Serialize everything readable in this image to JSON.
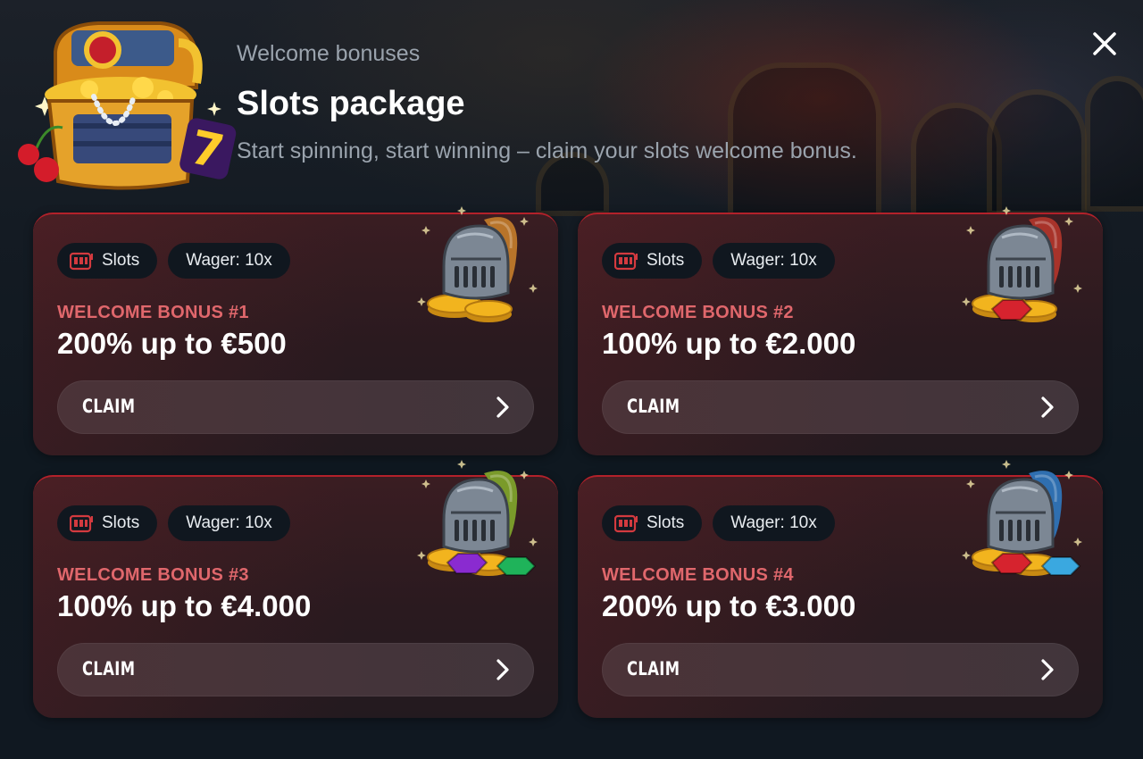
{
  "header": {
    "eyebrow": "Welcome bonuses",
    "title": "Slots package",
    "subtitle": "Start spinning, start winning – claim your slots welcome bonus."
  },
  "icons": {
    "close": "close-icon",
    "chest": "treasure-chest-icon",
    "slot": "slot-machine-icon",
    "chevron": "chevron-right-icon",
    "helmet": "knight-helmet-icon"
  },
  "colors": {
    "accent_red": "#e0676c",
    "card_border": "#b3212a",
    "background": "#0f1820"
  },
  "cards": [
    {
      "tag_type": "Slots",
      "tag_wager": "Wager: 10x",
      "label": "WELCOME BONUS #1",
      "amount": "200% up to €500",
      "button": "CLAIM",
      "plume": "#b8742a",
      "gems": []
    },
    {
      "tag_type": "Slots",
      "tag_wager": "Wager: 10x",
      "label": "WELCOME BONUS #2",
      "amount": "100% up to €2.000",
      "button": "CLAIM",
      "plume": "#a8332a",
      "gems": [
        "#d6232e"
      ]
    },
    {
      "tag_type": "Slots",
      "tag_wager": "Wager: 10x",
      "label": "WELCOME BONUS #3",
      "amount": "100% up to €4.000",
      "button": "CLAIM",
      "plume": "#7a9a2a",
      "gems": [
        "#8a2bd0",
        "#1fb35a"
      ]
    },
    {
      "tag_type": "Slots",
      "tag_wager": "Wager: 10x",
      "label": "WELCOME BONUS #4",
      "amount": "200% up to €3.000",
      "button": "CLAIM",
      "plume": "#2f6fb0",
      "gems": [
        "#d6232e",
        "#3aa8e0"
      ]
    }
  ]
}
